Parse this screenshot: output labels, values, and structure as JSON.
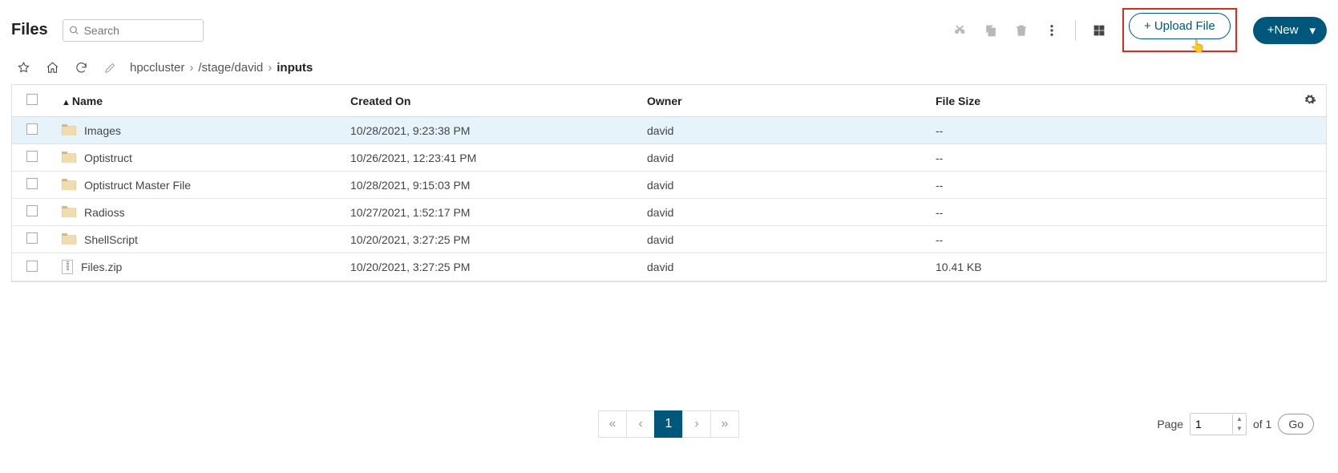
{
  "header": {
    "title": "Files",
    "search_placeholder": "Search",
    "upload_label": "Upload File",
    "new_label": "New"
  },
  "breadcrumb": {
    "root": "hpccluster",
    "path": "/stage/david",
    "current": "inputs"
  },
  "columns": {
    "name": "Name",
    "created": "Created On",
    "owner": "Owner",
    "size": "File Size"
  },
  "rows": [
    {
      "type": "folder",
      "name": "Images",
      "created": "10/28/2021, 9:23:38 PM",
      "owner": "david",
      "size": "--",
      "highlight": true
    },
    {
      "type": "folder",
      "name": "Optistruct",
      "created": "10/26/2021, 12:23:41 PM",
      "owner": "david",
      "size": "--",
      "highlight": false
    },
    {
      "type": "folder",
      "name": "Optistruct Master File",
      "created": "10/28/2021, 9:15:03 PM",
      "owner": "david",
      "size": "--",
      "highlight": false
    },
    {
      "type": "folder",
      "name": "Radioss",
      "created": "10/27/2021, 1:52:17 PM",
      "owner": "david",
      "size": "--",
      "highlight": false
    },
    {
      "type": "folder",
      "name": "ShellScript",
      "created": "10/20/2021, 3:27:25 PM",
      "owner": "david",
      "size": "--",
      "highlight": false
    },
    {
      "type": "zip",
      "name": "Files.zip",
      "created": "10/20/2021, 3:27:25 PM",
      "owner": "david",
      "size": "10.41 KB",
      "highlight": false
    }
  ],
  "pager": {
    "label_page": "Page",
    "current": "1",
    "of_label": "of 1",
    "go_label": "Go",
    "active_page": "1"
  }
}
